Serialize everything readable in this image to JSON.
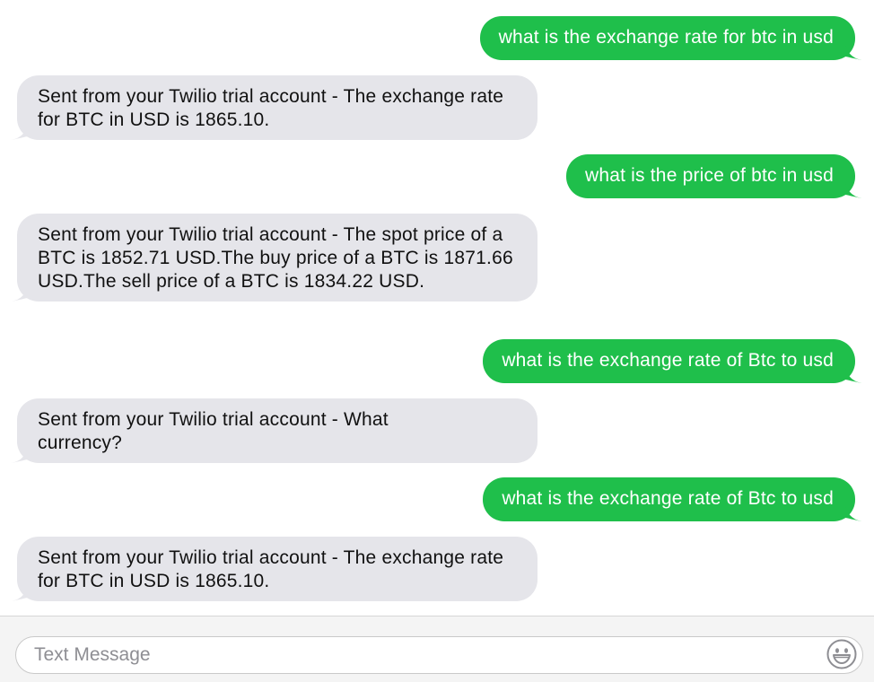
{
  "conversation": {
    "messages": [
      {
        "direction": "sent",
        "text": "what is the exchange rate for btc in usd"
      },
      {
        "direction": "received",
        "text": "Sent from your Twilio trial account - The exchange rate for BTC in USD is 1865.10."
      },
      {
        "direction": "sent",
        "text": "what is the price of btc in usd"
      },
      {
        "direction": "received",
        "text": "Sent from your Twilio trial account - The spot price of a BTC is 1852.71 USD.The buy price of a BTC is 1871.66 USD.The sell price of a BTC is 1834.22 USD."
      },
      {
        "direction": "sent",
        "text": "what is the exchange rate of Btc to usd"
      },
      {
        "direction": "received",
        "text": "Sent from your Twilio trial account - What currency?"
      },
      {
        "direction": "sent",
        "text": "what is the exchange rate of Btc to usd"
      },
      {
        "direction": "received",
        "text": "Sent from your Twilio trial account - The exchange rate for BTC in USD is 1865.10."
      }
    ]
  },
  "compose": {
    "placeholder": "Text Message",
    "value": "",
    "emoji_icon": "emoji-smiley-icon"
  },
  "colors": {
    "sent_bubble": "#1fbf4b",
    "received_bubble": "#e5e5ea",
    "sent_text": "#ffffff",
    "received_text": "#111111"
  }
}
